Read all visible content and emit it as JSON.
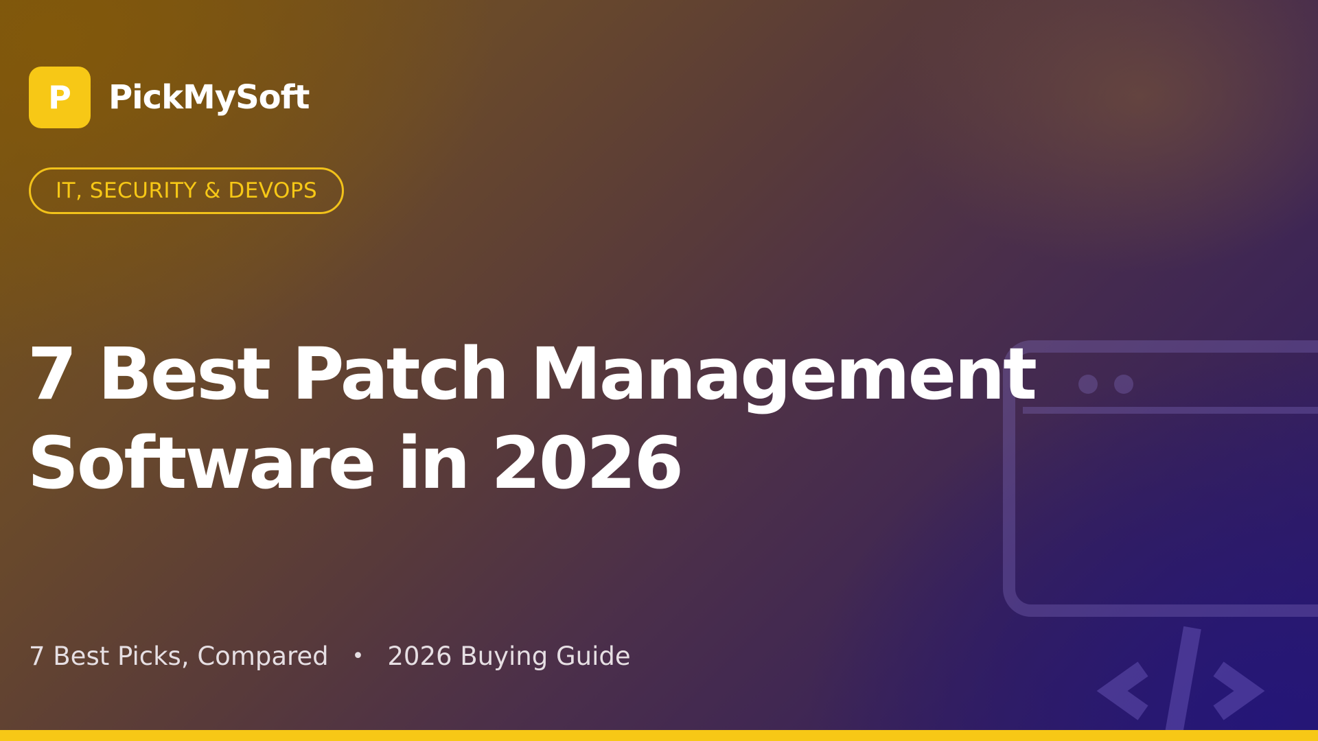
{
  "brand": {
    "logo_letter": "P",
    "name": "PickMySoft"
  },
  "category_badge": "IT, SECURITY & DEVOPS",
  "headline": {
    "line1": "7 Best Patch Management",
    "line2": "Software in 2026"
  },
  "subline": {
    "left": "7 Best Picks, Compared",
    "separator": "•",
    "right": "2026 Buying Guide"
  },
  "decoration": {
    "icon": "code-window-icon",
    "code_glyph": "</>"
  },
  "colors": {
    "accent": "#f7c816",
    "text": "#ffffff",
    "muted_text": "#e6dfe3"
  }
}
